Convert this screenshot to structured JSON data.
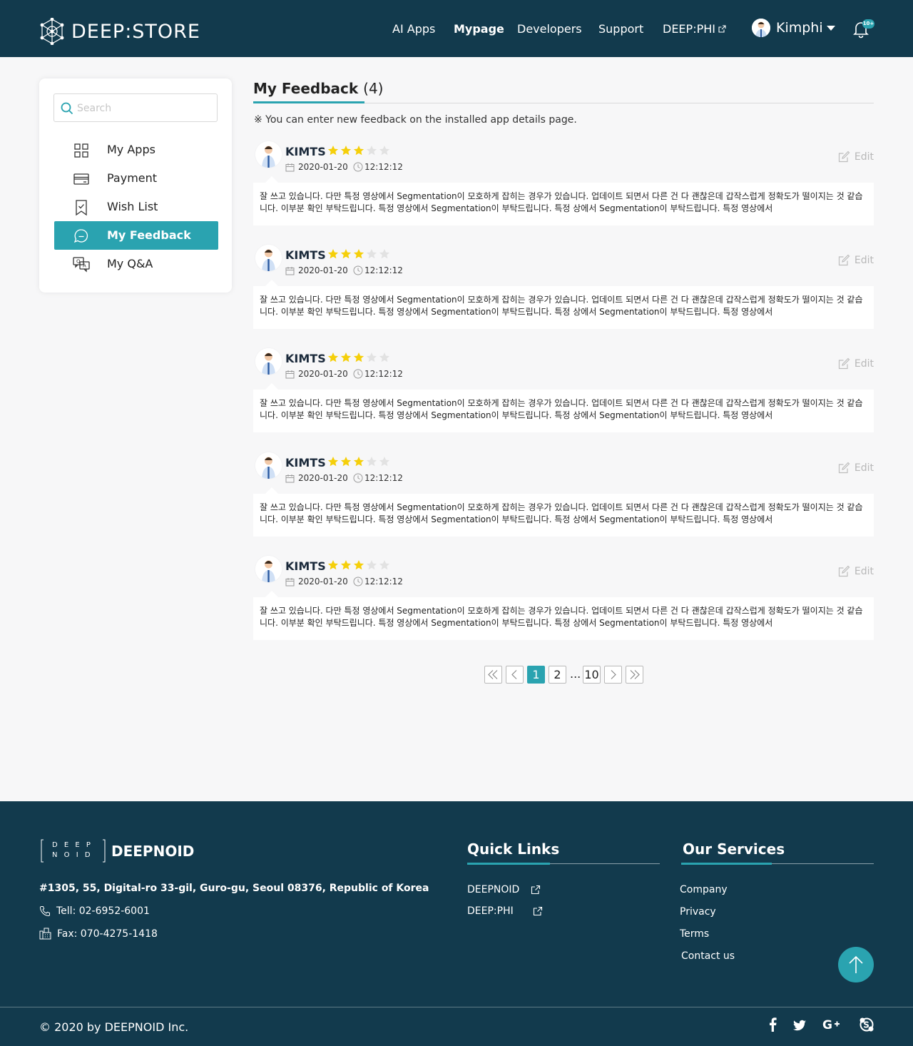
{
  "header": {
    "logo_text": "DEEP:STORE",
    "nav": [
      {
        "label": "AI Apps"
      },
      {
        "label": "Mypage"
      },
      {
        "label": "Developers"
      },
      {
        "label": "Support"
      },
      {
        "label": "DEEP:PHI"
      }
    ],
    "active_nav": "Mypage",
    "user_name": "Kimphi",
    "notification_badge": "10+"
  },
  "sidebar": {
    "search_placeholder": "Search",
    "items": [
      {
        "label": "My Apps",
        "icon": "grid-icon"
      },
      {
        "label": "Payment",
        "icon": "card-icon"
      },
      {
        "label": "Wish List",
        "icon": "bookmark-icon"
      },
      {
        "label": "My Feedback",
        "icon": "chat-icon"
      },
      {
        "label": "My Q&A",
        "icon": "qa-icon"
      }
    ],
    "active_item": "My Feedback"
  },
  "main": {
    "title": "My Feedback",
    "count": "(4)",
    "notice": "※ You can enter new feedback on the installed app details page.",
    "edit_label": "Edit",
    "feedbacks": [
      {
        "name": "KIMTS",
        "rating": 3,
        "max_rating": 5,
        "date": "2020-01-20",
        "time": "12:12:12",
        "text": "잘 쓰고 있습니다. 다만 특정 영상에서 Segmentation이 모호하게 잡히는 경우가 있습니다. 업데이트 되면서 다른 건 다 괜찮은데 갑작스럽게 정확도가 떨이지는 것 같습니다. 이부분 확인 부탁드립니다. 특정 영상에서 Segmentation이 부탁드립니다. 특정  상에서 Segmentation이 부탁드립니다. 특정 영상에서"
      },
      {
        "name": "KIMTS",
        "rating": 3,
        "max_rating": 5,
        "date": "2020-01-20",
        "time": "12:12:12",
        "text": "잘 쓰고 있습니다. 다만 특정 영상에서 Segmentation이 모호하게 잡히는 경우가 있습니다. 업데이트 되면서 다른 건 다 괜찮은데 갑작스럽게 정확도가 떨이지는 것 같습니다. 이부분 확인 부탁드립니다. 특정 영상에서 Segmentation이 부탁드립니다. 특정  상에서 Segmentation이 부탁드립니다. 특정 영상에서"
      },
      {
        "name": "KIMTS",
        "rating": 3,
        "max_rating": 5,
        "date": "2020-01-20",
        "time": "12:12:12",
        "text": "잘 쓰고 있습니다. 다만 특정 영상에서 Segmentation이 모호하게 잡히는 경우가 있습니다. 업데이트 되면서 다른 건 다 괜찮은데 갑작스럽게 정확도가 떨이지는 것 같습니다. 이부분 확인 부탁드립니다. 특정 영상에서 Segmentation이 부탁드립니다. 특정  상에서 Segmentation이 부탁드립니다. 특정 영상에서"
      },
      {
        "name": "KIMTS",
        "rating": 3,
        "max_rating": 5,
        "date": "2020-01-20",
        "time": "12:12:12",
        "text": "잘 쓰고 있습니다. 다만 특정 영상에서 Segmentation이 모호하게 잡히는 경우가 있습니다. 업데이트 되면서 다른 건 다 괜찮은데 갑작스럽게 정확도가 떨이지는 것 같습니다. 이부분 확인 부탁드립니다. 특정 영상에서 Segmentation이 부탁드립니다. 특정  상에서 Segmentation이 부탁드립니다. 특정 영상에서"
      },
      {
        "name": "KIMTS",
        "rating": 3,
        "max_rating": 5,
        "date": "2020-01-20",
        "time": "12:12:12",
        "text": "잘 쓰고 있습니다. 다만 특정 영상에서 Segmentation이 모호하게 잡히는 경우가 있습니다. 업데이트 되면서 다른 건 다 괜찮은데 갑작스럽게 정확도가 떨이지는 것 같습니다. 이부분 확인 부탁드립니다. 특정 영상에서 Segmentation이 부탁드립니다. 특정  상에서 Segmentation이 부탁드립니다. 특정 영상에서"
      }
    ]
  },
  "pagination": {
    "pages": [
      "1",
      "2",
      "10"
    ],
    "ellipsis": "...",
    "current": "1"
  },
  "footer": {
    "logo_mark_top": "D E E P",
    "logo_mark_bottom": "N O I D",
    "logo_text": "DEEPNOID",
    "address": "#1305, 55, Digital-ro 33-gil, Guro-gu, Seoul 08376, Republic of Korea",
    "tel": "Tell: 02-6952-6001",
    "fax": "Fax: 070-4275-1418",
    "quick_links_title": "Quick Links",
    "quick_links": [
      "DEEPNOID",
      "DEEP:PHI"
    ],
    "services_title": "Our Services",
    "services": [
      "Company",
      "Privacy",
      "Terms",
      "Contact us"
    ],
    "copyright": "© 2020 by DEEPNOID Inc.",
    "social": [
      "facebook-icon",
      "twitter-icon",
      "google-plus-icon",
      "skype-icon"
    ]
  },
  "colors": {
    "header_bg": "#123a4d",
    "accent": "#2aa3b0",
    "star": "#f5cf0a",
    "star_empty": "#e2e2e2",
    "page_bg": "#f7f7f8"
  }
}
